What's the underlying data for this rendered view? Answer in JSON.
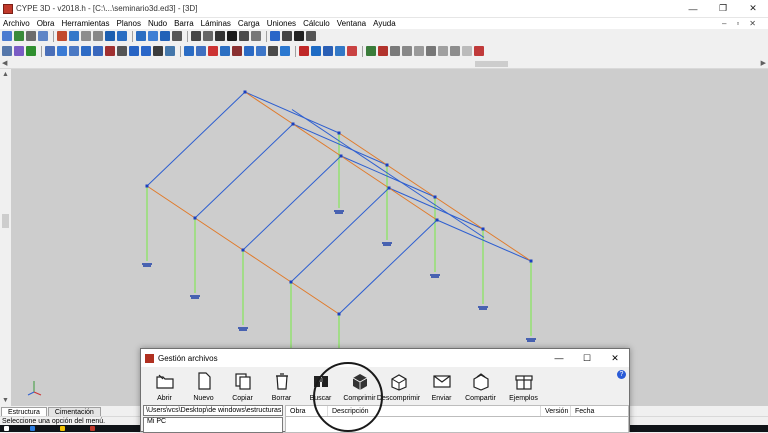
{
  "window": {
    "title": "CYPE 3D - v2018.h - [C:\\...\\seminario3d.ed3] - [3D]",
    "min_label": "—",
    "max_label": "❐",
    "close_label": "✕"
  },
  "menu": [
    {
      "label": "Archivo"
    },
    {
      "label": "Obra"
    },
    {
      "label": "Herramientas"
    },
    {
      "label": "Planos"
    },
    {
      "label": "Nudo"
    },
    {
      "label": "Barra"
    },
    {
      "label": "Láminas"
    },
    {
      "label": "Carga"
    },
    {
      "label": "Uniones"
    },
    {
      "label": "Cálculo"
    },
    {
      "label": "Ventana"
    },
    {
      "label": "Ayuda"
    }
  ],
  "mdi_buttons": {
    "min": "–",
    "restore": "▫",
    "close": "✕"
  },
  "toolbar1_colors": [
    "#4a7bd0",
    "#3a8b3a",
    "#6c6c6c",
    "#5f85c6",
    "#c14a2d",
    "#3478c9",
    "#8c8c8c",
    "#888888",
    "#1d5fb0",
    "#2a6dc2",
    "#2a6dc2",
    "#3f7fd4",
    "#2262b8",
    "#555555",
    "#444444",
    "#666666",
    "#333333",
    "#1a1a1a",
    "#4a4a4a",
    "#777777",
    "#2a66c8",
    "#444444",
    "#222222",
    "#555555"
  ],
  "toolbar2_colors": [
    "#5577aa",
    "#7a5cc4",
    "#2f8f2f",
    "#4a6fb8",
    "#3b7bd4",
    "#4b79c4",
    "#2e6bc5",
    "#3a68bd",
    "#a03030",
    "#555555",
    "#2864c4",
    "#2a66c8",
    "#3c3c3c",
    "#47a",
    "#2b6cc4",
    "#4070c0",
    "#cc3333",
    "#2c6fc2",
    "#8a3030",
    "#2a6ac4",
    "#3d76c8",
    "#4a4a4a",
    "#2b78d0",
    "#c02828",
    "#1e6bc4",
    "#2a5fb5",
    "#3378c6",
    "#c94242",
    "#3a7c3a",
    "#b2332d",
    "#7a7a7a",
    "#888888",
    "#9a9a9a",
    "#777777",
    "#a0a0a0",
    "#8d8d8d",
    "#bbbbbb",
    "#c03a3a"
  ],
  "tabs": [
    {
      "label": "Estructura",
      "active": true
    },
    {
      "label": "Cimentación",
      "active": false
    }
  ],
  "status": "Seleccione una opción del menú.",
  "dialog": {
    "title": "Gestión archivos",
    "min_label": "—",
    "max_label": "☐",
    "close_label": "✕",
    "help_label": "?",
    "tools": [
      {
        "label": "Abrir",
        "icon": "open-folder-icon"
      },
      {
        "label": "Nuevo",
        "icon": "new-file-icon"
      },
      {
        "label": "Copiar",
        "icon": "copy-icon"
      },
      {
        "label": "Borrar",
        "icon": "trash-icon"
      },
      {
        "label": "Buscar",
        "icon": "binoculars-icon"
      },
      {
        "label": "Comprimir",
        "icon": "compress-icon"
      },
      {
        "label": "Descomprimir",
        "icon": "decompress-icon"
      },
      {
        "label": "Enviar",
        "icon": "envelope-icon"
      },
      {
        "label": "Compartir",
        "icon": "share-icon"
      },
      {
        "label": "Ejemplos",
        "icon": "gift-icon"
      }
    ],
    "path": "\\Users\\vcs\\Desktop\\de windows\\estructuras 3d",
    "tree_item": "Mi PC",
    "columns": [
      "Obra",
      "Descripción",
      "Versión",
      "Fecha"
    ]
  },
  "colors": {
    "viewport_bg": "#cdcdcd",
    "beam_blue": "#2e5fd0",
    "beam_orange": "#e07a2a",
    "column_green": "#8fe36a",
    "node_blue": "#1a3fc0"
  }
}
